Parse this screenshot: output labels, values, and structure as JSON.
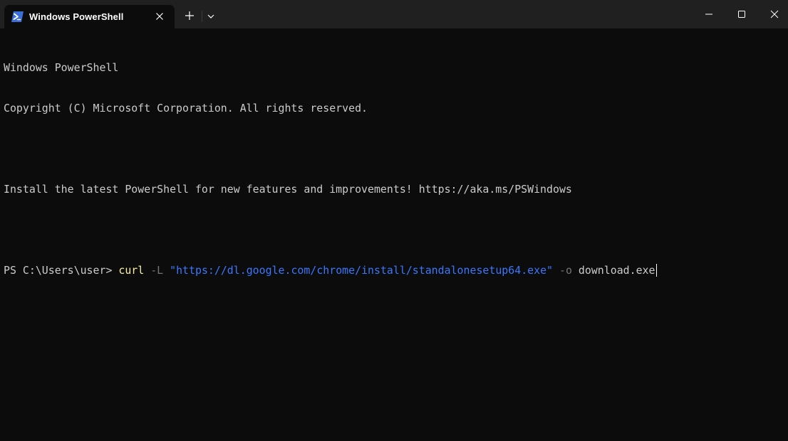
{
  "window": {
    "tab_title": "Windows PowerShell",
    "tab_icon": "powershell-icon",
    "close_tab_icon": "close-icon",
    "new_tab_icon": "plus-icon",
    "dropdown_icon": "chevron-down-icon",
    "minimize_icon": "minimize-icon",
    "maximize_icon": "maximize-icon",
    "close_window_icon": "close-icon"
  },
  "terminal": {
    "lines": [
      "Windows PowerShell",
      "Copyright (C) Microsoft Corporation. All rights reserved.",
      "",
      "Install the latest PowerShell for new features and improvements! https://aka.ms/PSWindows",
      ""
    ],
    "prompt": "PS C:\\Users\\user> ",
    "command": {
      "cmd": "curl",
      "flag1": "-L",
      "url": "\"https://dl.google.com/chrome/install/standalonesetup64.exe\"",
      "flag2": "-o",
      "output": "download.exe"
    }
  },
  "colors": {
    "background": "#0c0c0c",
    "titlebar": "#202020",
    "text": "#cccccc",
    "command": "#f9f1a5",
    "flag": "#767676",
    "string": "#3b78ff"
  }
}
